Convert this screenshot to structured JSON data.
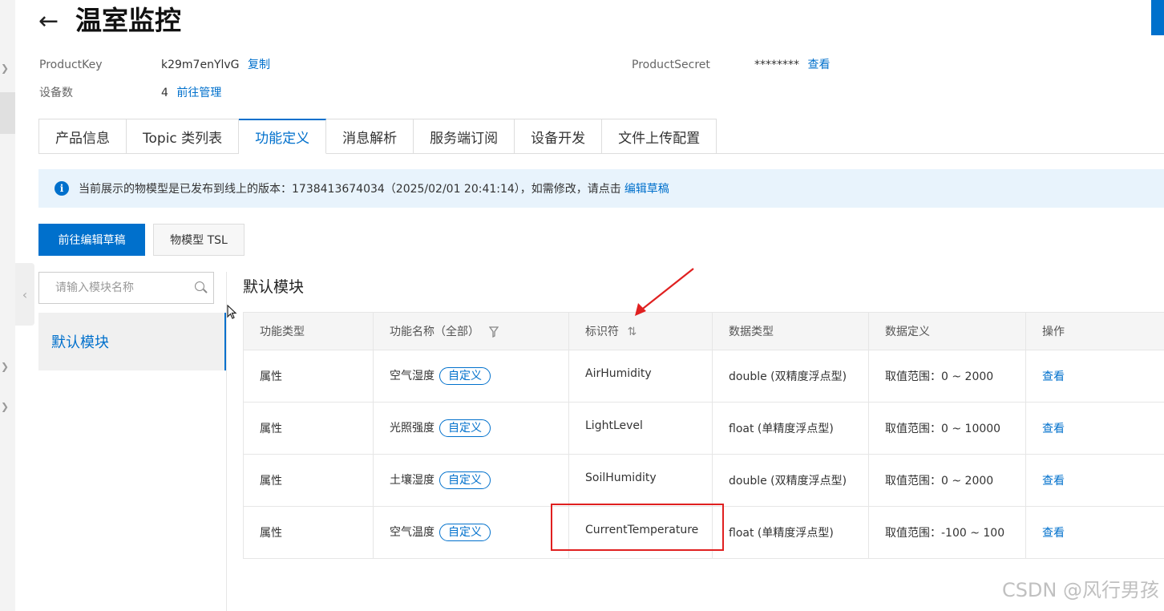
{
  "header": {
    "title": "温室监控"
  },
  "meta": {
    "product_key_label": "ProductKey",
    "product_key_value": "k29m7enYlvG",
    "copy_label": "复制",
    "product_secret_label": "ProductSecret",
    "product_secret_value": "********",
    "view_secret_label": "查看",
    "device_count_label": "设备数",
    "device_count_value": "4",
    "manage_label": "前往管理"
  },
  "tabs": [
    {
      "label": "产品信息"
    },
    {
      "label": "Topic 类列表"
    },
    {
      "label": "功能定义",
      "active": true
    },
    {
      "label": "消息解析"
    },
    {
      "label": "服务端订阅"
    },
    {
      "label": "设备开发"
    },
    {
      "label": "文件上传配置"
    }
  ],
  "notice": {
    "text": "当前展示的物模型是已发布到线上的版本：1738413674034（2025/02/01 20:41:14），如需修改，请点击",
    "link": "编辑草稿"
  },
  "buttons": {
    "edit_draft": "前往编辑草稿",
    "tsl": "物模型 TSL"
  },
  "sidebar": {
    "search_placeholder": "请输入模块名称",
    "modules": [
      "默认模块"
    ]
  },
  "section_title": "默认模块",
  "table": {
    "headers": [
      "功能类型",
      "功能名称（全部）",
      "标识符",
      "数据类型",
      "数据定义",
      "操作"
    ],
    "rows": [
      {
        "type": "属性",
        "name": "空气湿度",
        "tag": "自定义",
        "identifier": "AirHumidity",
        "data_type": "double (双精度浮点型)",
        "definition": "取值范围：0 ~ 2000",
        "action": "查看"
      },
      {
        "type": "属性",
        "name": "光照强度",
        "tag": "自定义",
        "identifier": "LightLevel",
        "data_type": "float (单精度浮点型)",
        "definition": "取值范围：0 ~ 10000",
        "action": "查看"
      },
      {
        "type": "属性",
        "name": "土壤湿度",
        "tag": "自定义",
        "identifier": "SoilHumidity",
        "data_type": "double (双精度浮点型)",
        "definition": "取值范围：0 ~ 2000",
        "action": "查看"
      },
      {
        "type": "属性",
        "name": "空气温度",
        "tag": "自定义",
        "identifier": "CurrentTemperature",
        "data_type": "float (单精度浮点型)",
        "definition": "取值范围：-100 ~ 100",
        "action": "查看"
      }
    ]
  },
  "watermark": "CSDN @风行男孩",
  "colors": {
    "accent": "#0070cc",
    "annotation": "#e02020",
    "notice_bg": "#e8f3fc"
  }
}
